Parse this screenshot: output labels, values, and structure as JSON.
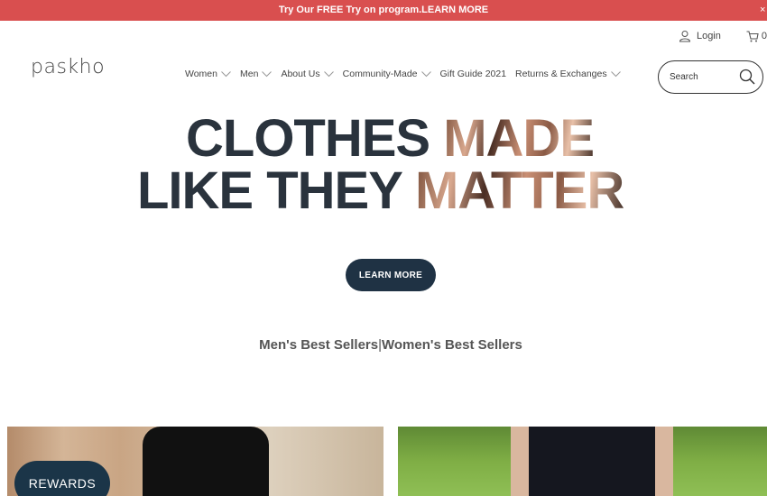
{
  "promo": {
    "text": "Try Our FREE Try on program.LEARN MORE",
    "close": "×"
  },
  "header": {
    "login_label": "Login",
    "cart_count": "0",
    "logo": "paskho",
    "search_placeholder": "Search"
  },
  "nav": {
    "items": [
      {
        "label": "Women",
        "has_dropdown": true
      },
      {
        "label": "Men",
        "has_dropdown": true
      },
      {
        "label": "About Us",
        "has_dropdown": true
      },
      {
        "label": "Community-Made",
        "has_dropdown": true
      },
      {
        "label": "Gift Guide 2021",
        "has_dropdown": false
      },
      {
        "label": "Returns & Exchanges",
        "has_dropdown": true
      }
    ]
  },
  "hero": {
    "line1_plain": "CLOTHES ",
    "line1_photo": "MADE",
    "line2_plain": "LIKE THEY ",
    "line2_photo": "MATTER",
    "button_label": "LEARN MORE"
  },
  "best_sellers": {
    "mens": "Men's Best Sellers",
    "separator": "|",
    "womens": "Women's Best Sellers"
  },
  "rewards": {
    "label": "REWARDS"
  },
  "colors": {
    "promo_bg": "#d94f4f",
    "hero_text": "#2a333d",
    "button_bg": "#1f3244",
    "rewards_bg": "#1b3548"
  }
}
